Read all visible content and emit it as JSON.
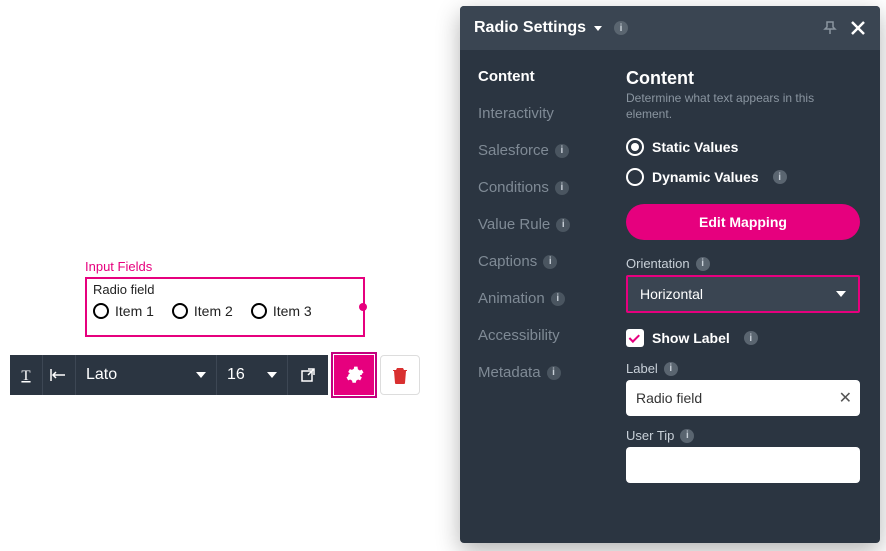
{
  "canvas": {
    "groupLabel": "Input Fields",
    "fieldTitle": "Radio field",
    "items": [
      "Item 1",
      "Item 2",
      "Item 3"
    ]
  },
  "toolbar": {
    "font": "Lato",
    "size": "16"
  },
  "panel": {
    "title": "Radio Settings",
    "nav": {
      "content": "Content",
      "interactivity": "Interactivity",
      "salesforce": "Salesforce",
      "conditions": "Conditions",
      "valueRule": "Value Rule",
      "captions": "Captions",
      "animation": "Animation",
      "accessibility": "Accessibility",
      "metadata": "Metadata"
    },
    "content": {
      "heading": "Content",
      "sub": "Determine what text appears in this element.",
      "staticLabel": "Static Values",
      "dynamicLabel": "Dynamic Values",
      "editMapping": "Edit Mapping",
      "orientationLabel": "Orientation",
      "orientationValue": "Horizontal",
      "showLabel": "Show Label",
      "labelLabel": "Label",
      "labelValue": "Radio field",
      "userTipLabel": "User Tip",
      "userTipValue": ""
    }
  }
}
